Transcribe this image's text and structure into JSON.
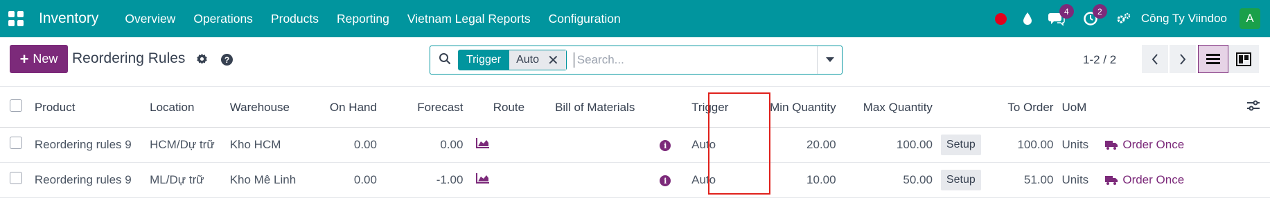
{
  "navbar": {
    "app_name": "Inventory",
    "menu": [
      "Overview",
      "Operations",
      "Products",
      "Reporting",
      "Vietnam Legal Reports",
      "Configuration"
    ],
    "messages_count": "4",
    "activities_count": "2",
    "company": "Công Ty Viindoo",
    "avatar_letter": "A",
    "brand_color": "#01959e"
  },
  "control": {
    "new_label": "New",
    "page_title": "Reordering Rules",
    "search": {
      "facet_name": "Trigger",
      "facet_value": "Auto",
      "placeholder": "Search..."
    },
    "pager": "1-2 / 2"
  },
  "table": {
    "headers": {
      "product": "Product",
      "location": "Location",
      "warehouse": "Warehouse",
      "on_hand": "On Hand",
      "forecast": "Forecast",
      "route": "Route",
      "bom": "Bill of Materials",
      "trigger": "Trigger",
      "min_qty": "Min Quantity",
      "max_qty": "Max Quantity",
      "to_order": "To Order",
      "uom": "UoM"
    },
    "rows": [
      {
        "product": "Reordering rules 9",
        "location": "HCM/Dự trữ",
        "warehouse": "Kho HCM",
        "on_hand": "0.00",
        "forecast": "0.00",
        "trigger": "Auto",
        "min_qty": "20.00",
        "max_qty": "100.00",
        "setup": "Setup",
        "to_order": "100.00",
        "uom": "Units",
        "action": "Order Once"
      },
      {
        "product": "Reordering rules 9",
        "location": "ML/Dự trữ",
        "warehouse": "Kho Mê Linh",
        "on_hand": "0.00",
        "forecast": "-1.00",
        "trigger": "Auto",
        "min_qty": "10.00",
        "max_qty": "50.00",
        "setup": "Setup",
        "to_order": "51.00",
        "uom": "Units",
        "action": "Order Once"
      }
    ]
  },
  "colors": {
    "primary": "#7c2a7a",
    "highlight": "#e0201b"
  }
}
